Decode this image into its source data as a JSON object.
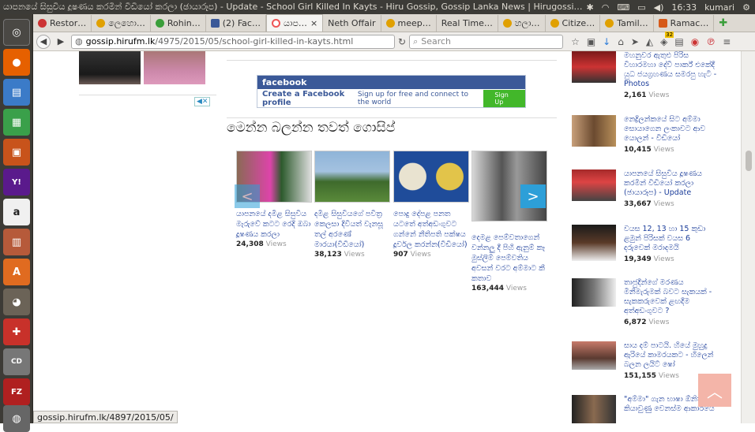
{
  "window": {
    "title": "යාපනයේ සිසුවිය දූෂණය කරමින් වීඩියෝ කරලා (ඡායාරූප) - Update - School Girl Killed In Kayts - Hiru Gossip, Gossip Lanka News | Hirugossip | Hi"
  },
  "tray": {
    "clock": "16:33",
    "user": "kumari"
  },
  "tabs": [
    {
      "label": "Restor…",
      "color": "#c33"
    },
    {
      "label": "ලෙහො…",
      "color": "#e0a000"
    },
    {
      "label": "Rohin…",
      "color": "#3a9e3a"
    },
    {
      "label": "(2) Fac…",
      "color": "#3b5998"
    },
    {
      "label": "යාප…",
      "color": "#e55"
    },
    {
      "label": "Neth Offair",
      "color": ""
    },
    {
      "label": "meep…",
      "color": "#e0a000"
    },
    {
      "label": "Real Time…",
      "color": ""
    },
    {
      "label": "හලා…",
      "color": "#e0a000"
    },
    {
      "label": "Citize…",
      "color": "#e0a000"
    },
    {
      "label": "Tamil…",
      "color": "#e0a000"
    },
    {
      "label": "Ramac…",
      "color": "#d65a1a"
    }
  ],
  "navbar": {
    "url_host": "gossip.hirufm.lk",
    "url_path": "/4975/2015/05/school-girl-killed-in-kayts.html",
    "search_placeholder": "Search",
    "badge": "32"
  },
  "fb_ad": {
    "brand": "facebook",
    "create": "Create a Facebook profile",
    "sub": "Sign up for free and connect to the world",
    "signup": "Sign Up"
  },
  "section": {
    "title": "මෙන්න බලන්න තවත් ගොසිප්"
  },
  "cards": [
    {
      "caption": "යාපනයේ දමිළ සිසුවිය මැරුවේ කටට රෙදි ඔබා දූෂණය කරලා",
      "views": "24,308",
      "views_label": "Views"
    },
    {
      "caption": "දමිළ සිසුවියගේ පවිත්‍ර කෙලසා දිවියත් වැනසූ තල් අරණේ මාරයා(වීඩියෝ)",
      "views": "38,123",
      "views_label": "Views"
    },
    {
      "caption": "පොදු දේපළ පනත යටතේ අත්අඩංගුවට ගන්නේ නීතිපති පක්ෂය දූර්වල කරන්න(වීඩියෝ)",
      "views": "907",
      "views_label": "Views"
    },
    {
      "caption": "දෙමළ පෙම්වතාගෙන් වන්නලු දී පිහි ඇනුම් කෑ මුස්ලිම් පෙම්වතිය අවසන් වරට අම්මාට කී කතාව",
      "views": "163,444",
      "views_label": "Views"
    }
  ],
  "sidebar": [
    {
      "caption": "මහනුවර ඇතුළු පිරිස විහාරමහා දේවී පාර්ක් එකේදී යුධ ජයග්‍රහණය සමරපු හැටි -Photos",
      "views": "2,161",
      "views_label": "Views"
    },
    {
      "caption": "නෙද්‍රිලන්කයේ සිට අම්මා සොයාගෙන ලංකාවට ආව යොලන් - වීඩියෝ",
      "views": "10,415",
      "views_label": "Views"
    },
    {
      "caption": "යාපනයේ සිසුවිය දූෂණය කරමින් වීඩියෝ කරලා (ඡායාරූප) - Update",
      "views": "33,667",
      "views_label": "Views"
    },
    {
      "caption": "වයස 12, 13 හා 15 කුඩා ළමුන් පිරිසක් වයස 6 දරුවෙක් මරාදමයි",
      "views": "19,349",
      "views_label": "Views"
    },
    {
      "caption": "තාජුදීන්ගේ මරණය මිනීමැරුමක් බවට සැකයක් - සැකකරුවෙක් ළඟදීම අත්අඩංගුවට ?",
      "views": "6,872",
      "views_label": "Views"
    },
    {
      "caption": "සාය දම් පාටයි. හියේ මුහුදු ඇරියේ කාමරයකට - හිලෙන් බලන ලයිට් ෂෝ",
      "views": "151,155",
      "views_label": "Views"
    },
    {
      "caption": "\"අම්මා\" ගැන භාෂා ඕනිත් කියාවුණු වෙනස්ම ආකාරයේ",
      "views": "",
      "views_label": ""
    }
  ],
  "status": {
    "link": "gossip.hirufm.lk/4897/2015/05/"
  }
}
